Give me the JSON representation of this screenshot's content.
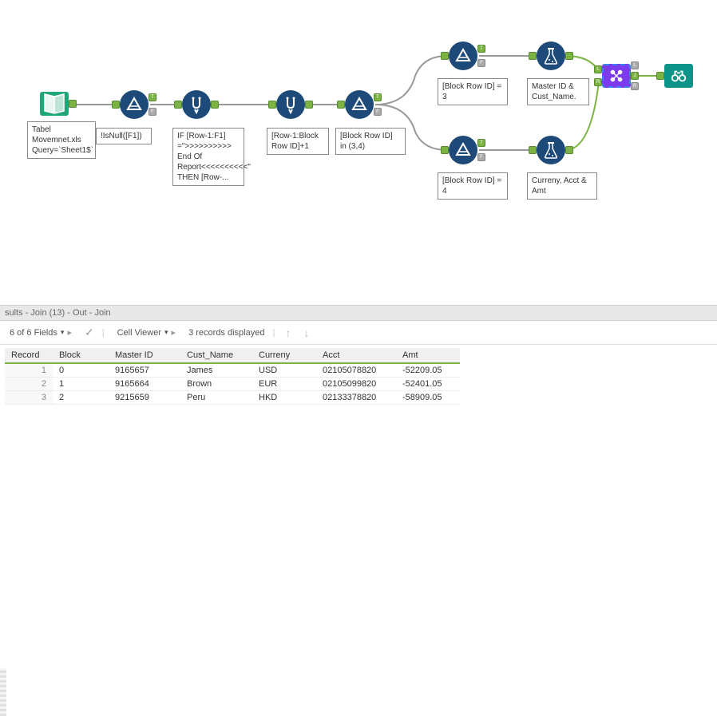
{
  "canvas": {
    "tool1_label": "Tabel Movemnet.xls Query=`Sheet1$`",
    "tool2_label": "!IsNull([F1])",
    "tool3_label": "IF [Row-1:F1] =\">>>>>>>>>> End Of Report<<<<<<<<<<\" THEN [Row-...",
    "tool4_label": "[Row-1:Block Row ID]+1",
    "tool5_label": "[Block Row ID] in (3,4)",
    "tool6_label": "[Block Row ID] = 3",
    "tool7_label": "[Block Row ID] = 4",
    "tool8_label": "Master ID & Cust_Name.",
    "tool9_label": "Curreny, Acct & Amt",
    "join_L": "L",
    "join_J": "J",
    "join_R": "R"
  },
  "results": {
    "header": "sults - Join (13) - Out - Join",
    "fields_label": "6 of 6 Fields",
    "cell_viewer": "Cell Viewer",
    "records_label": "3 records displayed",
    "columns": [
      "Record",
      "Block",
      "Master ID",
      "Cust_Name",
      "Curreny",
      "Acct",
      "Amt"
    ],
    "rows": [
      {
        "rec": "1",
        "block": "0",
        "master": "9165657",
        "name": "James",
        "curr": "USD",
        "acct": "02105078820",
        "amt": "-52209.05"
      },
      {
        "rec": "2",
        "block": "1",
        "master": "9165664",
        "name": "Brown",
        "curr": "EUR",
        "acct": "02105099820",
        "amt": "-52401.05"
      },
      {
        "rec": "3",
        "block": "2",
        "master": "9215659",
        "name": "Peru",
        "curr": "HKD",
        "acct": "02133378820",
        "amt": "-58909.05"
      }
    ]
  }
}
